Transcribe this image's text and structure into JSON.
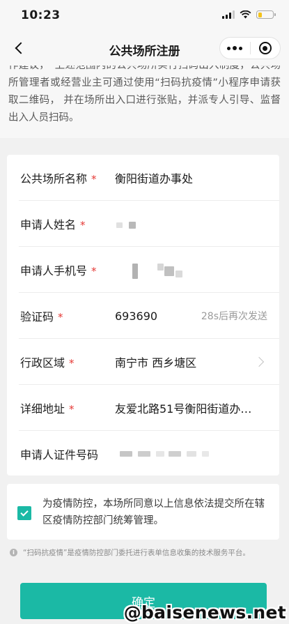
{
  "status": {
    "time": "10:23",
    "battery_level": 0.25,
    "battery_color": "#f4c21b"
  },
  "nav": {
    "title": "公共场所注册",
    "back_icon": "chevron-left-icon",
    "more_icon": "more-dots-icon",
    "close_icon": "target-circle-icon"
  },
  "intro": {
    "text": "作建议，“上述范围内的公共场所实行扫码出入制度，公共场所管理者或经营业主可通过使用“扫码抗疫情”小程序申请获取二维码， 并在场所出入口进行张贴，并派专人引导、监督出入人员扫码。"
  },
  "form": {
    "required_mark": "*",
    "venue_name": {
      "label": "公共场所名称",
      "value": "衡阳街道办事处"
    },
    "applicant_name": {
      "label": "申请人姓名"
    },
    "applicant_phone": {
      "label": "申请人手机号"
    },
    "verification_code": {
      "label": "验证码",
      "value": "693690",
      "resend_text": "28s后再次发送"
    },
    "district": {
      "label": "行政区域",
      "value": "南宁市 西乡塘区"
    },
    "address": {
      "label": "详细地址",
      "value": "友爱北路51号衡阳街道办…"
    },
    "id_number": {
      "label": "申请人证件号码"
    }
  },
  "consent": {
    "checked": true,
    "text": "为疫情防控，本场所同意以上信息依法提交所在辖区疫情防控部门统筹管理。"
  },
  "notice": {
    "icon": "info-icon",
    "text": "“扫码抗疫情”是疫情防控部门委托进行表单信息收集的技术服务平台。"
  },
  "confirm": {
    "label": "确定"
  },
  "watermark": {
    "text": "@baisenews.net"
  },
  "colors": {
    "accent": "#1bb9a5",
    "required": "#e53935"
  }
}
